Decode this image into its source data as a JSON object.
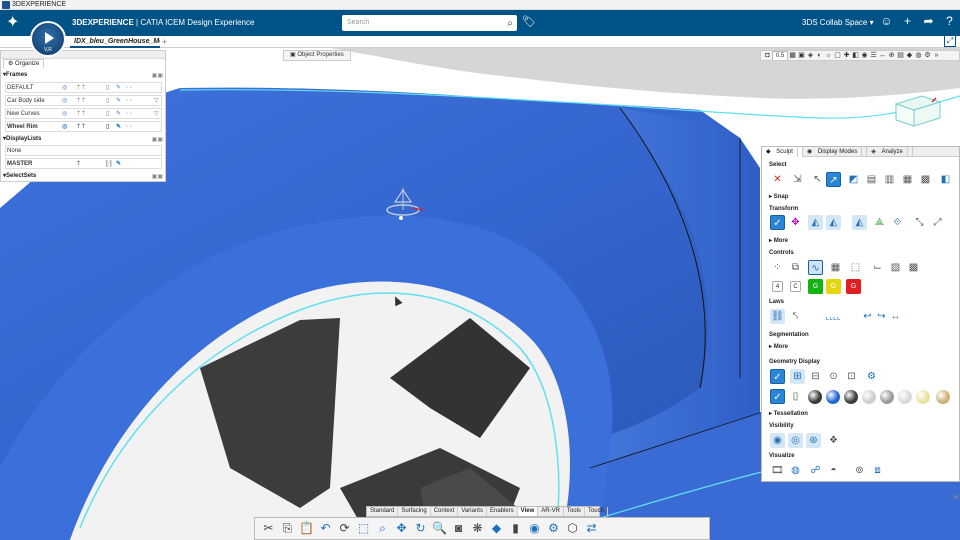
{
  "titlebar": {
    "title": "3DEXPERIENCE"
  },
  "topbar": {
    "brand_strong": "3DEXPERIENCE",
    "brand_rest": " | CATIA ICEM Design Experience",
    "compass_label": "V,R",
    "search_placeholder": "Search",
    "collab_space": "3DS Collab Space",
    "icons": [
      "user-icon",
      "add-icon",
      "share-icon",
      "help-icon"
    ]
  },
  "document": {
    "tab_label": "IDX_bleu_GreenHouse_Mo",
    "add_tab": "+"
  },
  "object_properties": {
    "label": "Object Properties"
  },
  "view_toolbar": {
    "zoom_value": "0.5"
  },
  "organize": {
    "tab": "Organize",
    "frames": {
      "title": "Frames",
      "rows": [
        {
          "name": "DEFAULT",
          "bold": false
        },
        {
          "name": "Car Body side",
          "bold": false
        },
        {
          "name": "New Curves",
          "bold": false
        },
        {
          "name": "Wheel Rim",
          "bold": true
        }
      ]
    },
    "displaylists": {
      "title": "DisplayLists",
      "rows": [
        "None",
        "MASTER"
      ]
    },
    "selectsets": {
      "title": "SelectSets"
    }
  },
  "right_panel": {
    "tabs": [
      "Sculpt",
      "Display Modes",
      "Analyze"
    ],
    "sections": {
      "select": "Select",
      "snap": "Snap",
      "transform": "Transform",
      "more1": "More",
      "controls": "Controls",
      "control_labels": [
        "4",
        "C"
      ],
      "laws": "Laws",
      "segmentation": "Segmentation",
      "more2": "More",
      "geometry_display": "Geometry Display",
      "tessellation": "Tessellation",
      "visibility": "Visibility",
      "visualize": "Visualize"
    },
    "color_swatches": [
      "#3a3a3a",
      "#1f66d1",
      "#3d3d3d",
      "#cfcfcf",
      "#9a9a9a",
      "#d8d8d8",
      "#e7e3a0",
      "#d0b07a",
      "#c89058"
    ]
  },
  "bottom_tabs": [
    "Standard",
    "Surfacing",
    "Context",
    "Variants",
    "Enablers",
    "View",
    "AR-VR",
    "Tools",
    "Touch"
  ],
  "bottom_tabs_active": "View",
  "colors": {
    "topbar": "#005386",
    "surface": "#3a6fd8",
    "accent": "#2b85d6"
  }
}
